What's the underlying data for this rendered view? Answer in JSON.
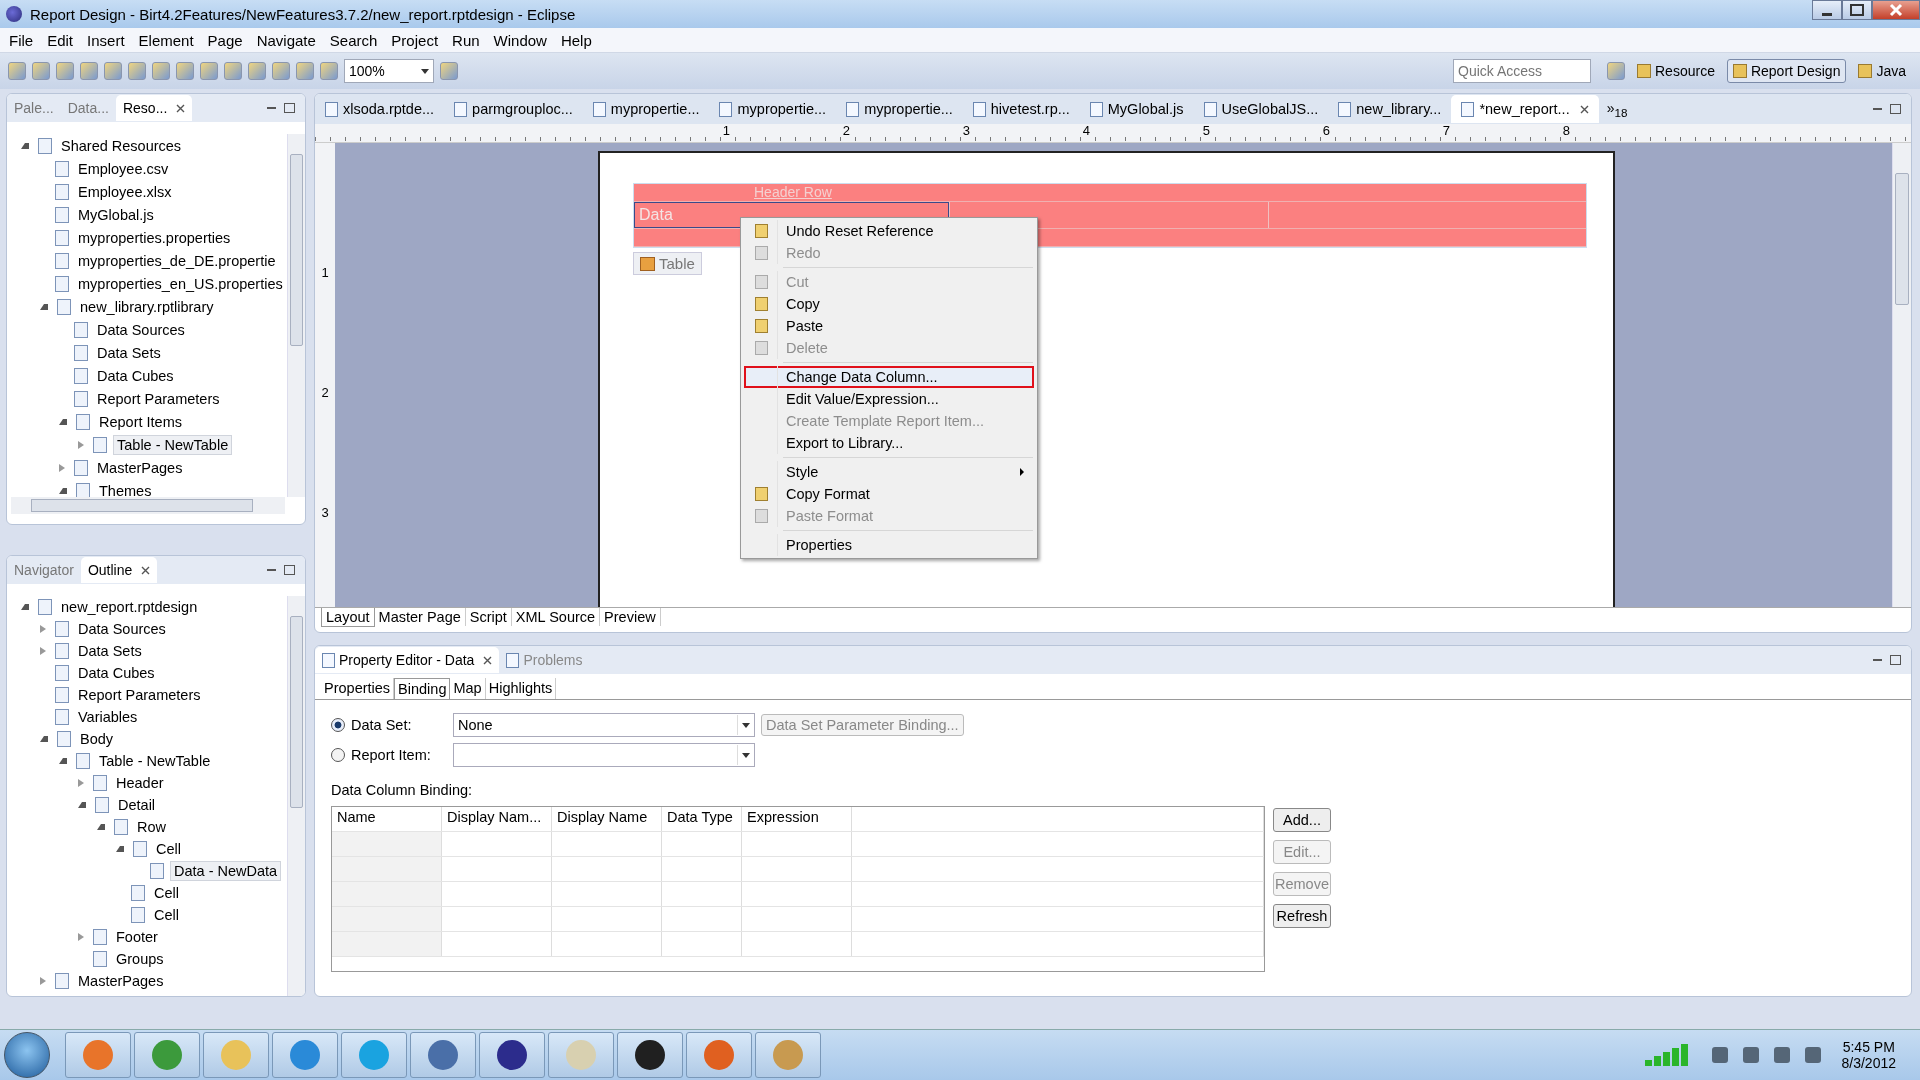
{
  "window": {
    "title": "Report Design - Birt4.2Features/NewFeatures3.7.2/new_report.rptdesign - Eclipse"
  },
  "menu_bar": [
    "File",
    "Edit",
    "Insert",
    "Element",
    "Page",
    "Navigate",
    "Search",
    "Project",
    "Run",
    "Window",
    "Help"
  ],
  "toolbar": {
    "zoom": "100%",
    "quick_access": {
      "placeholder": "Quick Access"
    },
    "perspectives": [
      {
        "label": "Resource",
        "selected": false
      },
      {
        "label": "Report Design",
        "selected": true
      },
      {
        "label": "Java",
        "selected": false
      }
    ]
  },
  "resource_panel": {
    "tabs": [
      {
        "label": "Pale...",
        "selected": false
      },
      {
        "label": "Data...",
        "selected": false
      },
      {
        "label": "Reso...",
        "selected": true
      }
    ],
    "tree": [
      {
        "label": "Shared Resources",
        "expanded": true,
        "selected": false,
        "children": [
          {
            "label": "Employee.csv",
            "selected": false
          },
          {
            "label": "Employee.xlsx",
            "selected": false
          },
          {
            "label": "MyGlobal.js",
            "selected": false
          },
          {
            "label": "myproperties.properties",
            "selected": false
          },
          {
            "label": "myproperties_de_DE.propertie",
            "selected": false
          },
          {
            "label": "myproperties_en_US.properties",
            "selected": false
          },
          {
            "label": "new_library.rptlibrary",
            "expanded": true,
            "selected": false,
            "children": [
              {
                "label": "Data Sources",
                "selected": false
              },
              {
                "label": "Data Sets",
                "selected": false
              },
              {
                "label": "Data Cubes",
                "selected": false
              },
              {
                "label": "Report Parameters",
                "selected": false
              },
              {
                "label": "Report Items",
                "expanded": true,
                "selected": false,
                "children": [
                  {
                    "label": "Table - NewTable",
                    "expanded": false,
                    "selected": true
                  }
                ]
              },
              {
                "label": "MasterPages",
                "expanded": false,
                "selected": false
              },
              {
                "label": "Themes",
                "expanded": true,
                "selected": false
              }
            ]
          }
        ]
      }
    ]
  },
  "outline_panel": {
    "tabs": [
      {
        "label": "Navigator",
        "selected": false
      },
      {
        "label": "Outline",
        "selected": true
      }
    ],
    "tree": [
      {
        "label": "new_report.rptdesign",
        "expanded": true,
        "selected": false,
        "children": [
          {
            "label": "Data Sources",
            "expanded": false,
            "selected": false
          },
          {
            "label": "Data Sets",
            "expanded": false,
            "selected": false
          },
          {
            "label": "Data Cubes",
            "selected": false
          },
          {
            "label": "Report Parameters",
            "selected": false
          },
          {
            "label": "Variables",
            "selected": false
          },
          {
            "label": "Body",
            "expanded": true,
            "selected": false,
            "children": [
              {
                "label": "Table - NewTable",
                "expanded": true,
                "selected": false,
                "children": [
                  {
                    "label": "Header",
                    "expanded": false,
                    "selected": false
                  },
                  {
                    "label": "Detail",
                    "expanded": true,
                    "selected": false,
                    "children": [
                      {
                        "label": "Row",
                        "expanded": true,
                        "selected": false,
                        "children": [
                          {
                            "label": "Cell",
                            "expanded": true,
                            "selected": false,
                            "children": [
                              {
                                "label": "Data - NewData",
                                "selected": true
                              }
                            ]
                          },
                          {
                            "label": "Cell",
                            "selected": false
                          },
                          {
                            "label": "Cell",
                            "selected": false
                          }
                        ]
                      }
                    ]
                  },
                  {
                    "label": "Footer",
                    "expanded": false,
                    "selected": false
                  },
                  {
                    "label": "Groups",
                    "selected": false
                  }
                ]
              }
            ]
          },
          {
            "label": "MasterPages",
            "expanded": false,
            "selected": false
          }
        ]
      }
    ]
  },
  "editor": {
    "tabs": [
      {
        "label": "xlsoda.rptde...",
        "selected": false
      },
      {
        "label": "parmgrouploc...",
        "selected": false
      },
      {
        "label": "mypropertie...",
        "selected": false
      },
      {
        "label": "mypropertie...",
        "selected": false
      },
      {
        "label": "mypropertie...",
        "selected": false
      },
      {
        "label": "hivetest.rp...",
        "selected": false
      },
      {
        "label": "MyGlobal.js",
        "selected": false
      },
      {
        "label": "UseGlobalJS...",
        "selected": false
      },
      {
        "label": "new_library...",
        "selected": false
      },
      {
        "label": "*new_report...",
        "selected": true
      }
    ],
    "overflow": {
      "symbol": "»",
      "count": "18"
    },
    "ruler": {
      "horizontal": [
        "1",
        "2",
        "3",
        "4",
        "5",
        "6",
        "7",
        "8"
      ],
      "vertical": [
        "1",
        "2",
        "3"
      ]
    },
    "report": {
      "header_label": "Header Row",
      "data_cell": "Data",
      "table_label": "Table"
    },
    "context_menu": [
      {
        "kind": "item",
        "label": "Undo Reset Reference",
        "icon": true,
        "disabled": false,
        "selected": false
      },
      {
        "kind": "item",
        "label": "Redo",
        "icon": true,
        "disabled": true,
        "selected": false
      },
      {
        "kind": "separator"
      },
      {
        "kind": "item",
        "label": "Cut",
        "icon": true,
        "disabled": true,
        "selected": false
      },
      {
        "kind": "item",
        "label": "Copy",
        "icon": true,
        "disabled": false,
        "selected": false
      },
      {
        "kind": "item",
        "label": "Paste",
        "icon": true,
        "disabled": false,
        "selected": false
      },
      {
        "kind": "item",
        "label": "Delete",
        "icon": true,
        "disabled": true,
        "selected": false
      },
      {
        "kind": "separator"
      },
      {
        "kind": "item",
        "label": "Change Data Column...",
        "disabled": false,
        "selected": true
      },
      {
        "kind": "item",
        "label": "Edit Value/Expression...",
        "disabled": false,
        "selected": false
      },
      {
        "kind": "item",
        "label": "Create Template Report Item...",
        "disabled": true,
        "selected": false
      },
      {
        "kind": "item",
        "label": "Export to Library...",
        "disabled": false,
        "selected": false
      },
      {
        "kind": "separator"
      },
      {
        "kind": "item",
        "label": "Style",
        "disabled": false,
        "selected": false,
        "submenu": true
      },
      {
        "kind": "item",
        "label": "Copy Format",
        "icon": true,
        "disabled": false,
        "selected": false
      },
      {
        "kind": "item",
        "label": "Paste Format",
        "icon": true,
        "disabled": true,
        "selected": false
      },
      {
        "kind": "separator"
      },
      {
        "kind": "item",
        "label": "Properties",
        "disabled": false,
        "selected": false
      }
    ],
    "bottom_tabs": [
      {
        "label": "Layout",
        "selected": true
      },
      {
        "label": "Master Page",
        "selected": false
      },
      {
        "label": "Script",
        "selected": false
      },
      {
        "label": "XML Source",
        "selected": false
      },
      {
        "label": "Preview",
        "selected": false
      }
    ]
  },
  "property_editor": {
    "tabs": [
      {
        "label": "Property Editor - Data",
        "selected": true
      },
      {
        "label": "Problems",
        "selected": false
      }
    ],
    "sub_tabs": [
      {
        "label": "Properties",
        "selected": false
      },
      {
        "label": "Binding",
        "selected": true
      },
      {
        "label": "Map",
        "selected": false
      },
      {
        "label": "Highlights",
        "selected": false
      }
    ],
    "sources": [
      {
        "label": "Data Set:",
        "selected": true,
        "value": "None"
      },
      {
        "label": "Report Item:",
        "selected": false
      }
    ],
    "parameter_button": {
      "label": "Data Set Parameter Binding...",
      "disabled": true
    },
    "binding_label": "Data Column Binding:",
    "columns": [
      "Name",
      "Display Nam...",
      "Display Name",
      "Data Type",
      "Expression"
    ],
    "buttons": [
      {
        "label": "Add...",
        "disabled": false
      },
      {
        "label": "Edit...",
        "disabled": true
      },
      {
        "label": "Remove",
        "disabled": true
      },
      {
        "label": "Refresh",
        "disabled": false
      }
    ]
  },
  "taskbar": {
    "apps": [
      {
        "color": "#e8742a"
      },
      {
        "color": "#3c9a3c"
      },
      {
        "color": "#e8c25a"
      },
      {
        "color": "#2a8ad8"
      },
      {
        "color": "#1aa3e0"
      },
      {
        "color": "#4a6fa8"
      },
      {
        "color": "#2c2c8c"
      },
      {
        "color": "#d8d0b0"
      },
      {
        "color": "#202020"
      },
      {
        "color": "#e06020"
      },
      {
        "color": "#c89a50"
      }
    ],
    "time": "5:45 PM",
    "date": "8/3/2012"
  }
}
